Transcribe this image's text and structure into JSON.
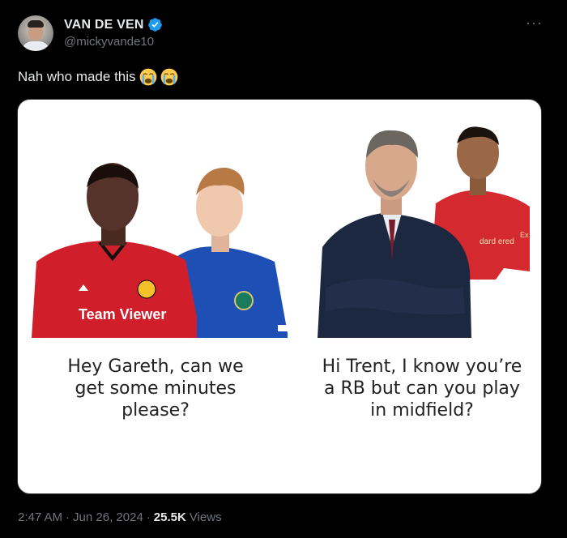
{
  "author": {
    "display_name": "VAN DE VEN",
    "handle": "@mickyvande10",
    "verified_badge_color": "#1d9bf0"
  },
  "tweet": {
    "text": "Nah who made this",
    "emoji": [
      "loudly-crying-face",
      "loudly-crying-face"
    ]
  },
  "media": {
    "left_caption": "Hey Gareth, can we get some minutes please?",
    "right_caption": "Hi Trent, I know you’re a RB but can you play in midfield?",
    "left_shirt_text": "Team Viewer",
    "right_sleeve_text": "Ex",
    "right_shirt_text": "dard ered"
  },
  "meta": {
    "time": "2:47 AM",
    "separator": "·",
    "date": "Jun 26, 2024",
    "views_count": "25.5K",
    "views_label": "Views"
  }
}
